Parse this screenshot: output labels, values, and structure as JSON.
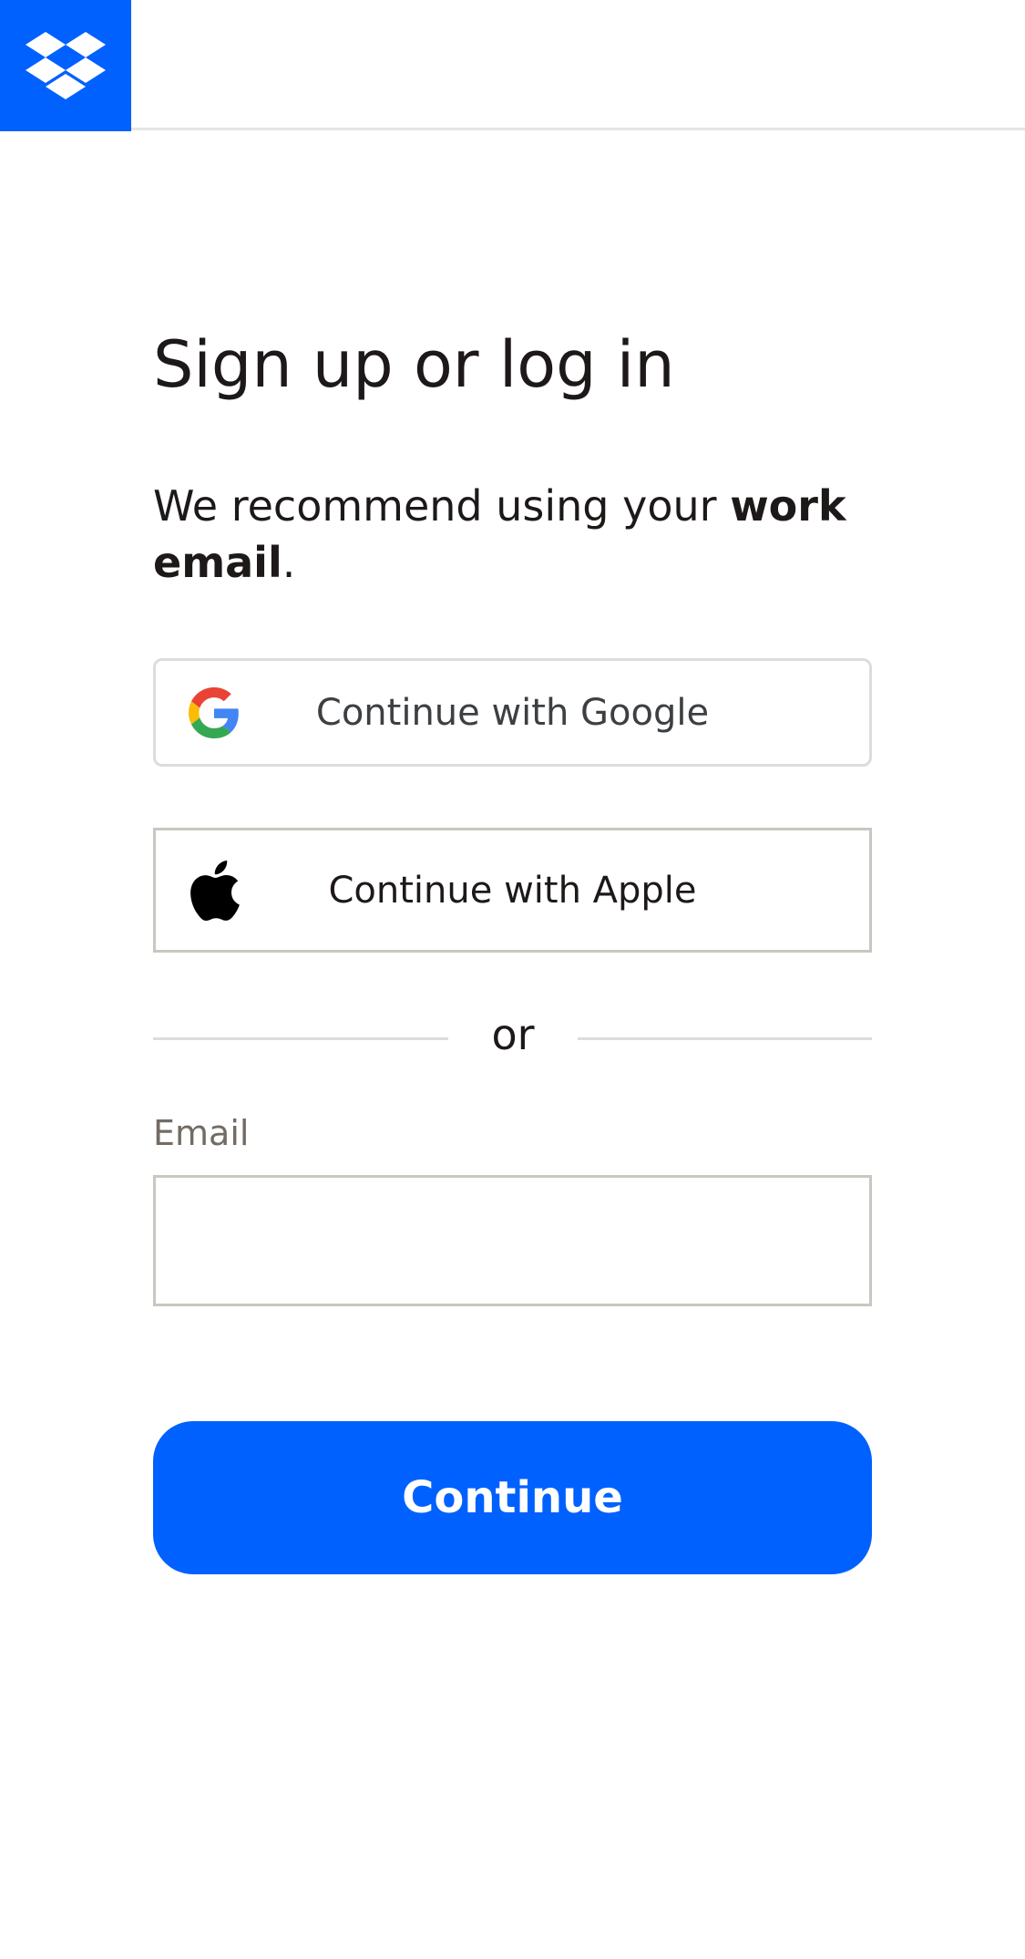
{
  "brand": {
    "logo_icon": "dropbox-logo-icon",
    "accent_color": "#0061fe"
  },
  "page": {
    "title": "Sign up or log in",
    "subtitle_prefix": "We recommend using your ",
    "subtitle_emphasis": "work email",
    "subtitle_suffix": "."
  },
  "social": {
    "google_label": "Continue with Google",
    "google_icon": "google-icon",
    "apple_label": "Continue with Apple",
    "apple_icon": "apple-icon"
  },
  "divider": {
    "text": "or"
  },
  "email": {
    "label": "Email",
    "value": "",
    "placeholder": ""
  },
  "actions": {
    "continue_label": "Continue"
  }
}
